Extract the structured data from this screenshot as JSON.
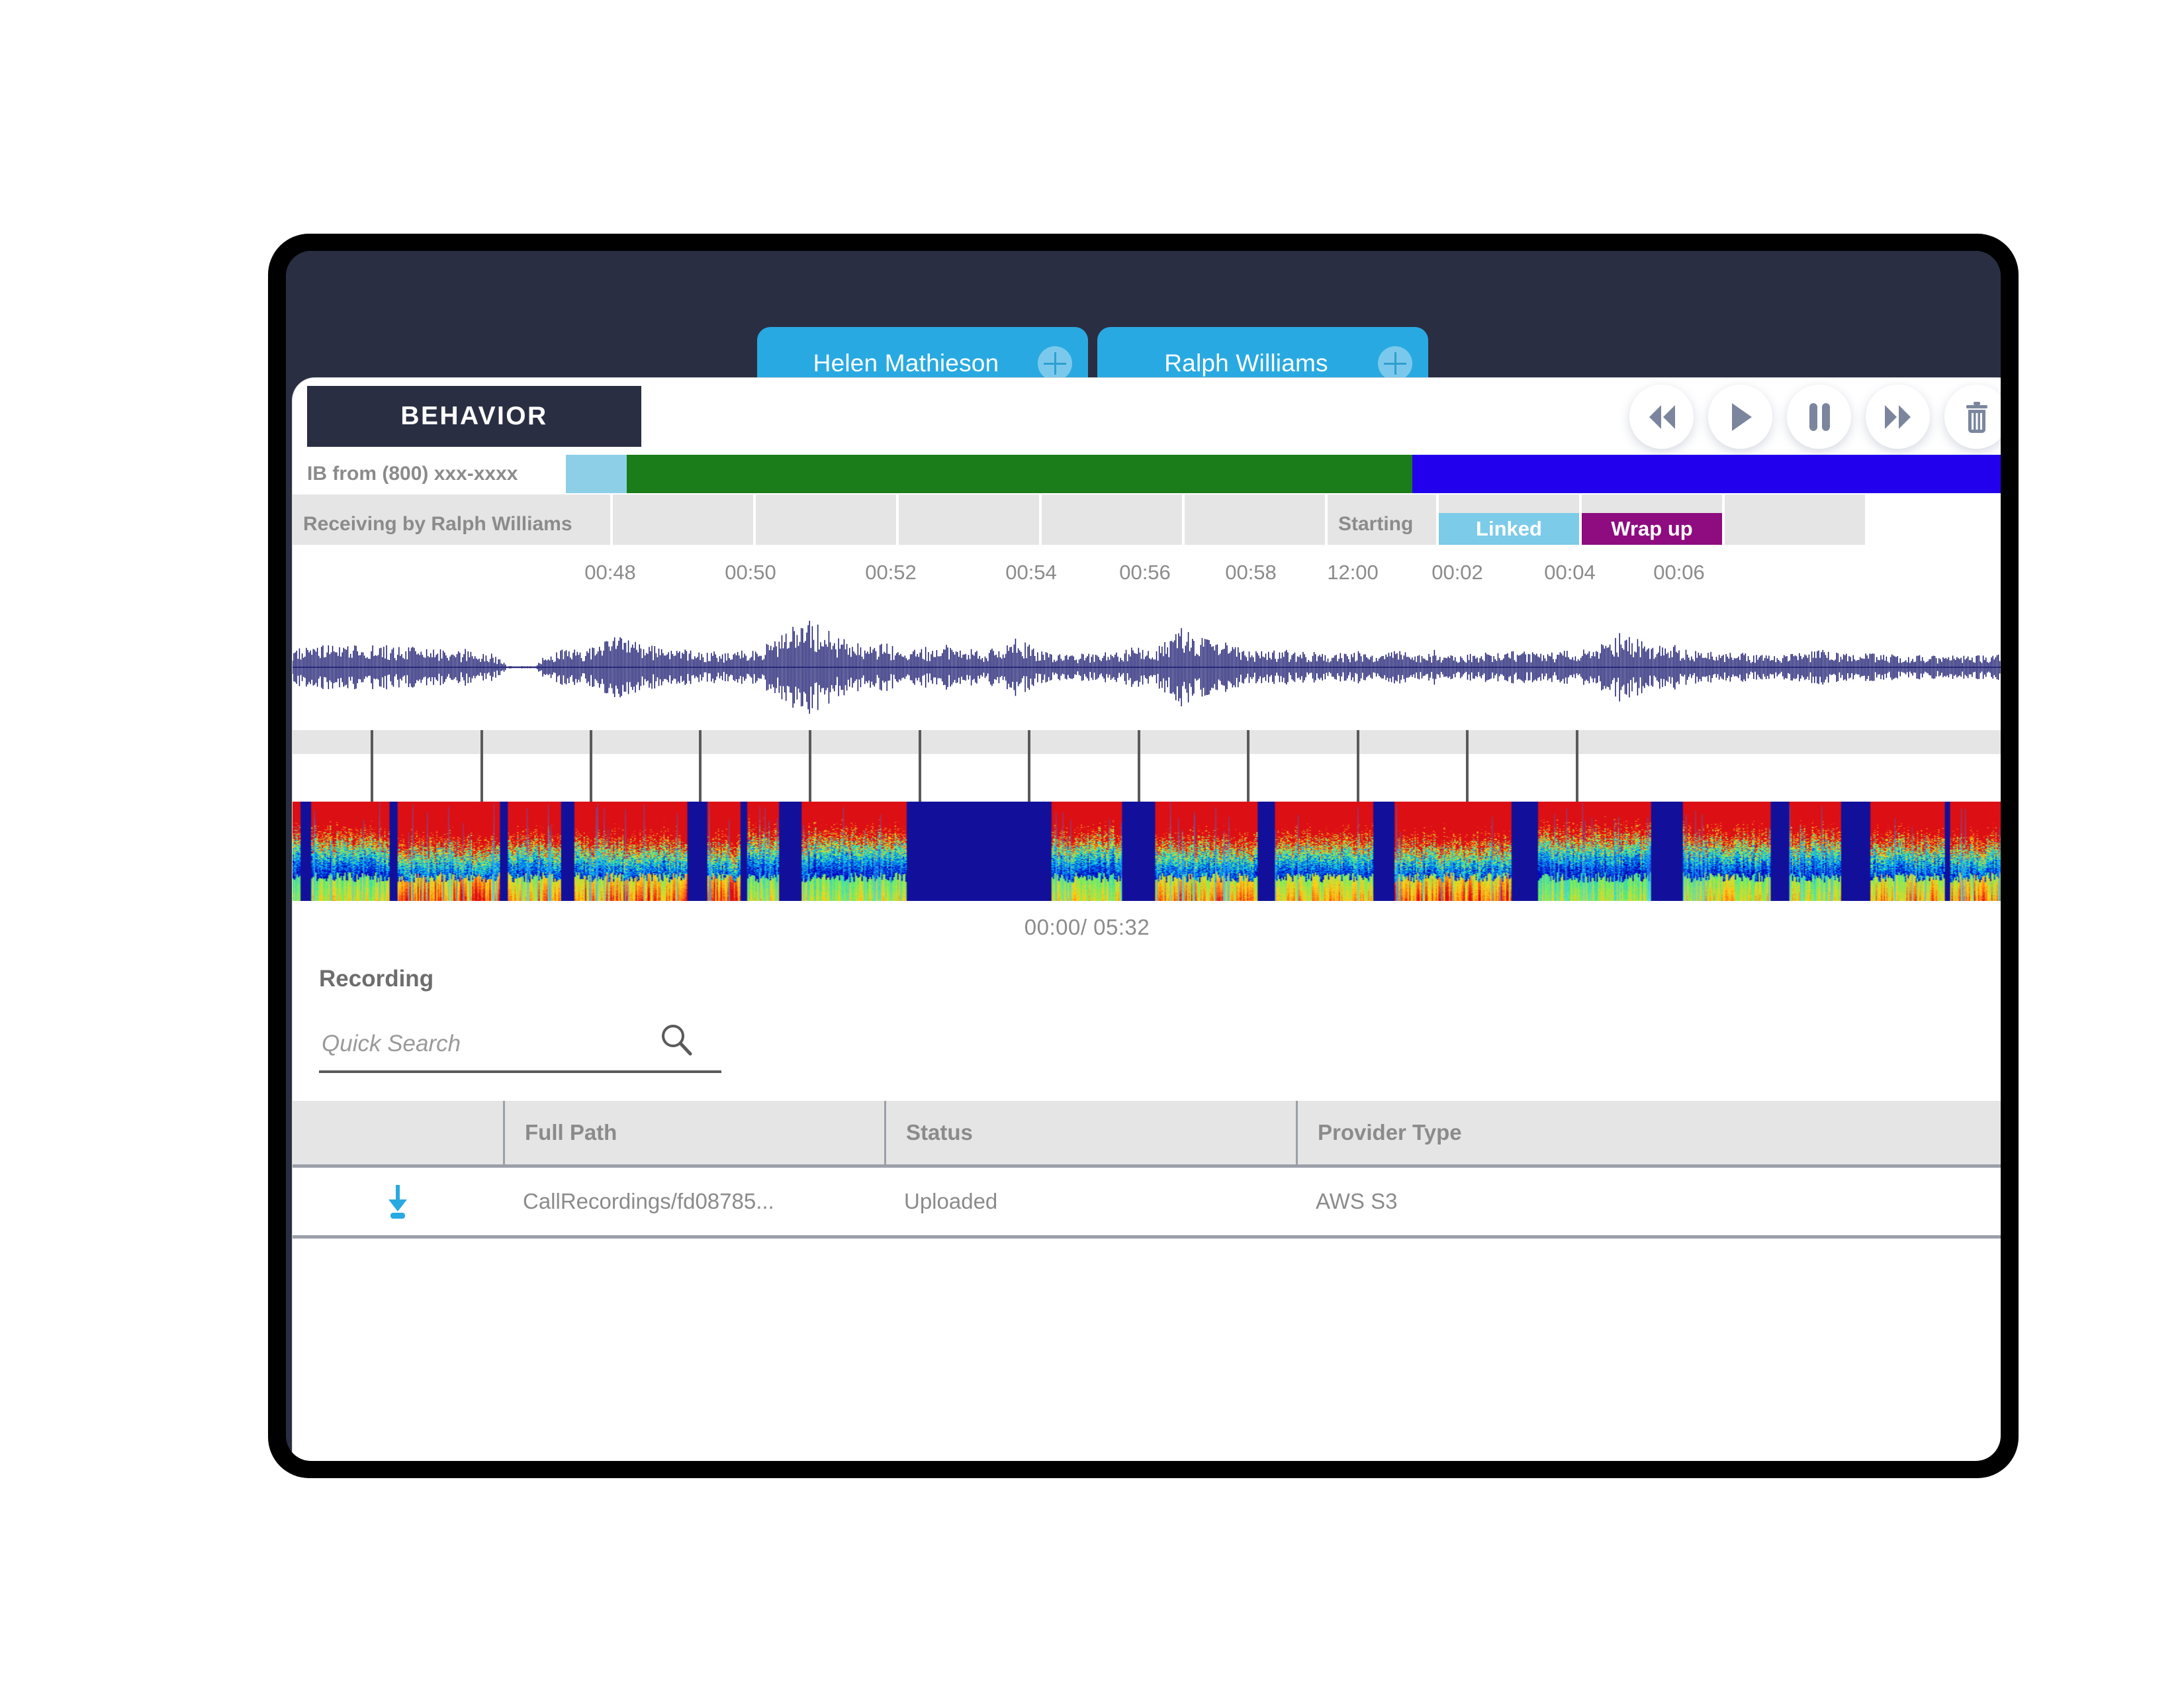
{
  "tabs": [
    {
      "label": "Helen Mathieson",
      "icon": "plus-circle-icon"
    },
    {
      "label": "Ralph Williams",
      "icon": "plus-circle-icon"
    }
  ],
  "panel": {
    "title": "BEHAVIOR",
    "transport": [
      {
        "name": "rewind-button",
        "icon": "rewind-icon"
      },
      {
        "name": "play-button",
        "icon": "play-icon"
      },
      {
        "name": "pause-button",
        "icon": "pause-icon"
      },
      {
        "name": "forward-button",
        "icon": "fast-forward-icon"
      },
      {
        "name": "delete-button",
        "icon": "trash-icon"
      }
    ]
  },
  "call_row": {
    "label": "IB from (800) xxx-xxxx",
    "segments": [
      {
        "name": "ringing",
        "color": "#8ecfe8",
        "width_pct": 2.6
      },
      {
        "name": "talking",
        "color": "#1a7d1a",
        "width_pct": 33.0
      },
      {
        "name": "after-call",
        "color": "#2200ee",
        "width_pct": 12.4
      }
    ]
  },
  "agent_row": {
    "label": "Receiving by Ralph Williams",
    "states": [
      {
        "label": "Starting",
        "name": "state-starting"
      },
      {
        "label": "Linked",
        "name": "state-linked",
        "color": "#7ccbe8"
      },
      {
        "label": "Wrap up",
        "name": "state-wrapup",
        "color": "#8e0b80"
      }
    ]
  },
  "ruler": {
    "ticks": [
      "00:48",
      "00:50",
      "00:52",
      "00:54",
      "00:56",
      "00:58",
      "12:00",
      "00:02",
      "00:04",
      "00:06"
    ]
  },
  "player": {
    "time_display": "00:00/ 05:32",
    "current_time": "00:00",
    "duration": "05:32"
  },
  "recording": {
    "section_title": "Recording",
    "search_placeholder": "Quick Search",
    "search_value": "",
    "search_icon": "magnifier-icon",
    "columns": [
      "",
      "Full Path",
      "Status",
      "Provider Type"
    ],
    "rows": [
      {
        "download_icon": "download-icon",
        "full_path": "CallRecordings/fd08785...",
        "status": "Uploaded",
        "provider_type": "AWS S3"
      }
    ]
  },
  "colors": {
    "tab_blue": "#29a9e1",
    "dark_navy": "#2a2e42",
    "talk_green": "#1a7d1a",
    "after_call_blue": "#2200ee",
    "ring_light_blue": "#8ecfe8",
    "linked_blue": "#7ccbe8",
    "wrapup_purple": "#8e0b80",
    "waveform_navy": "#191970",
    "download_blue": "#29a9e1"
  }
}
